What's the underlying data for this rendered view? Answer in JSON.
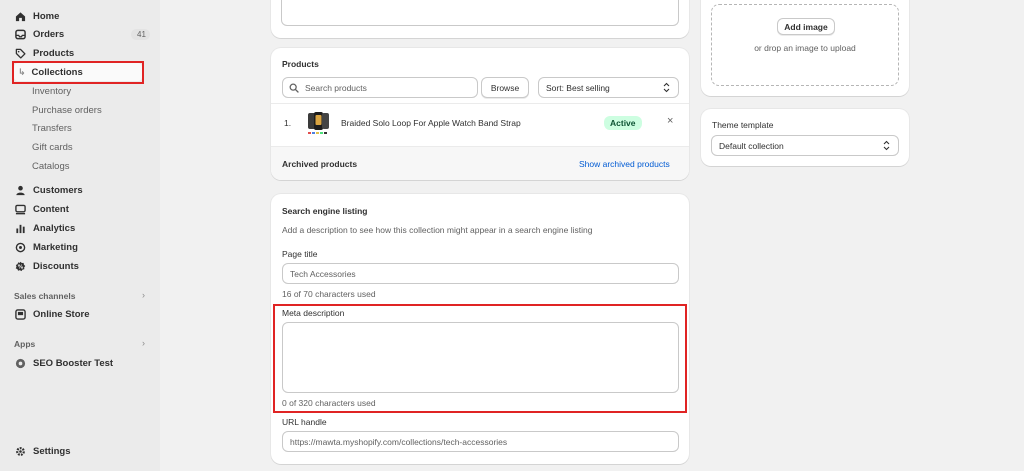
{
  "sidebar": {
    "home": "Home",
    "orders": "Orders",
    "orders_count": "41",
    "products": "Products",
    "collections": "Collections",
    "inventory": "Inventory",
    "purchase_orders": "Purchase orders",
    "transfers": "Transfers",
    "gift_cards": "Gift cards",
    "catalogs": "Catalogs",
    "customers": "Customers",
    "content": "Content",
    "analytics": "Analytics",
    "marketing": "Marketing",
    "discounts": "Discounts",
    "sales_channels": "Sales channels",
    "online_store": "Online Store",
    "apps": "Apps",
    "seo_booster": "SEO Booster Test",
    "settings": "Settings"
  },
  "products_card": {
    "title": "Products",
    "search_placeholder": "Search products",
    "browse_label": "Browse",
    "sort_label": "Sort: Best selling",
    "items": [
      {
        "index": "1.",
        "name": "Braided Solo Loop For Apple Watch Band Strap",
        "status": "Active"
      }
    ],
    "archived_label": "Archived products",
    "show_archived_label": "Show archived products"
  },
  "seo_card": {
    "title": "Search engine listing",
    "description": "Add a description to see how this collection might appear in a search engine listing",
    "page_title_label": "Page title",
    "page_title_value": "Tech Accessories",
    "page_title_count": "16 of 70 characters used",
    "meta_label": "Meta description",
    "meta_value": "",
    "meta_count": "0 of 320 characters used",
    "url_label": "URL handle",
    "url_value": "https://mawta.myshopify.com/collections/tech-accessories"
  },
  "image_card": {
    "add_image_label": "Add image",
    "drop_hint": "or drop an image to upload"
  },
  "theme_card": {
    "title": "Theme template",
    "selected": "Default collection"
  },
  "colors": {
    "accent_link": "#005bd3",
    "active_badge_bg": "#cdfee1",
    "active_badge_text": "#0c5132",
    "highlight_red": "#e02424"
  }
}
